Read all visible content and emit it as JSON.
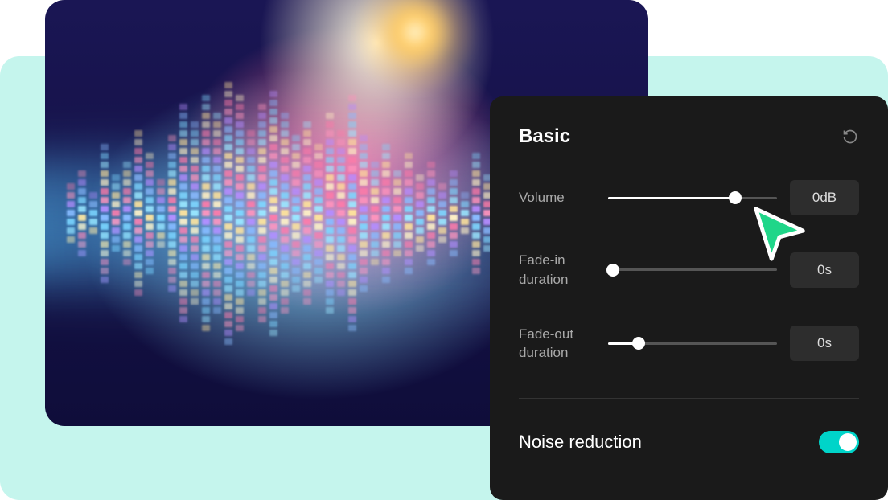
{
  "panel": {
    "title": "Basic",
    "controls": {
      "volume": {
        "label": "Volume",
        "value": "0dB",
        "position_percent": 75
      },
      "fade_in": {
        "label": "Fade-in duration",
        "value": "0s",
        "position_percent": 3
      },
      "fade_out": {
        "label": "Fade-out duration",
        "value": "0s",
        "position_percent": 18
      }
    },
    "noise_reduction": {
      "label": "Noise reduction",
      "enabled": true
    }
  },
  "colors": {
    "accent": "#00d4c9",
    "panel_bg": "#1a1a1a",
    "mint": "#c5f5ed",
    "cursor_green": "#1fd689"
  }
}
